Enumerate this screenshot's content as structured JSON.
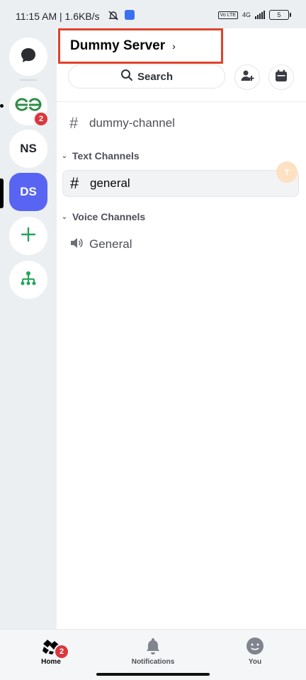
{
  "status_bar": {
    "time": "11:15 AM | 1.6KB/s",
    "network": "4G",
    "volte": "Vo LTE",
    "battery": "5"
  },
  "rail": {
    "servers": [
      {
        "name": "direct-messages",
        "label": ""
      },
      {
        "name": "gfg-server",
        "label": "",
        "badge": "2"
      },
      {
        "name": "ns-server",
        "label": "NS"
      },
      {
        "name": "ds-server",
        "label": "DS"
      },
      {
        "name": "add-server",
        "label": ""
      },
      {
        "name": "discover",
        "label": ""
      }
    ]
  },
  "header": {
    "server_name": "Dummy Server",
    "chevron": "›",
    "search_label": "Search"
  },
  "channels": {
    "uncategorized": [
      {
        "name": "dummy-channel",
        "type": "text"
      }
    ],
    "categories": [
      {
        "title": "Text Channels",
        "channels": [
          {
            "name": "general",
            "type": "text",
            "selected": true
          }
        ]
      },
      {
        "title": "Voice Channels",
        "channels": [
          {
            "name": "General",
            "type": "voice"
          }
        ]
      }
    ]
  },
  "bottom_nav": {
    "home": "Home",
    "home_badge": "2",
    "notifications": "Notifications",
    "you": "You"
  },
  "colors": {
    "accent": "#5865f2",
    "badge": "#da373c",
    "highlight_box": "#e0422b",
    "green": "#23a55a",
    "gfg_green": "#2f8d46"
  }
}
